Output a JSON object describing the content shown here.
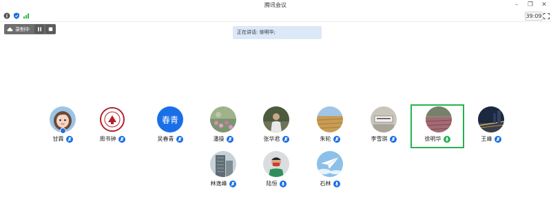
{
  "window": {
    "title": "腾讯会议"
  },
  "toolbar": {
    "timer": "39:09"
  },
  "recording": {
    "label": "录制中"
  },
  "speaking": {
    "text": "正在讲话: 徐明华;"
  },
  "colors": {
    "accent": "#1a6fe8",
    "active_border": "#23b24d",
    "speaking_bg": "#dbe8f8",
    "rec_panel": "#6e6e6e"
  },
  "participants": [
    {
      "name": "甘霖",
      "avatar": "cartoon-girl",
      "mic": "muted"
    },
    {
      "name": "周书钟",
      "avatar": "school-emblem",
      "mic": "muted"
    },
    {
      "name": "吴春青",
      "avatar": "text-avatar",
      "avatar_text": "春青",
      "mic": "muted"
    },
    {
      "name": "潘操",
      "avatar": "photo-flowers",
      "mic": "muted"
    },
    {
      "name": "张华君",
      "avatar": "photo-person",
      "mic": "muted"
    },
    {
      "name": "朱轮",
      "avatar": "photo-field",
      "mic": "muted"
    },
    {
      "name": "李雪琪",
      "avatar": "photo-sign",
      "mic": "muted"
    },
    {
      "name": "徐明华",
      "avatar": "photo-garden",
      "mic": "speaking",
      "active": true
    },
    {
      "name": "王峰",
      "avatar": "photo-city-night",
      "mic": "muted"
    },
    {
      "name": "林逸峰",
      "avatar": "photo-building",
      "mic": "muted"
    },
    {
      "name": "陆恒",
      "avatar": "photo-man-mask",
      "mic": "open"
    },
    {
      "name": "石林",
      "avatar": "photo-paper-plane",
      "mic": "open"
    }
  ]
}
